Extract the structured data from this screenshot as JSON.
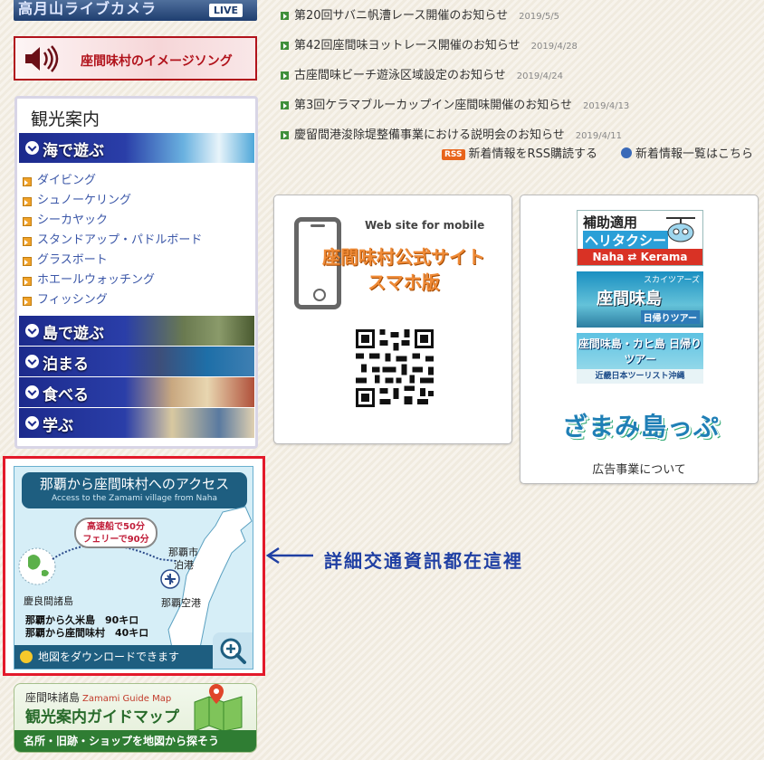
{
  "live_camera": {
    "title": "高月山ライブカメラ",
    "badge": "LIVE"
  },
  "image_song": {
    "label": "座間味村のイメージソング"
  },
  "sightseeing": {
    "title": "観光案内",
    "categories": [
      "海で遊ぶ",
      "島で遊ぶ",
      "泊まる",
      "食べる",
      "学ぶ"
    ],
    "sea_items": [
      "ダイビング",
      "シュノーケリング",
      "シーカヤック",
      "スタンドアップ・パドルボード",
      "グラスボート",
      "ホエールウォッチング",
      "フィッシング"
    ]
  },
  "access_map": {
    "title": "那覇から座間味村へのアクセス",
    "subtitle": "Access to the Zamami village from Naha",
    "balloon_1": "高速船で50分",
    "balloon_2": "フェリーで90分",
    "label_port_1": "那覇市",
    "label_port_2": "泊港",
    "label_airport": "那覇空港",
    "label_islands": "慶良間諸島",
    "dist_1": "那覇から久米島　90キロ",
    "dist_2": "那覇から座間味村　40キロ",
    "download": "地図をダウンロードできます"
  },
  "annotation": "詳細交通資訊都在這裡",
  "guide_map": {
    "line1": "座間味諸島",
    "line1_en": "Zamami Guide Map",
    "title": "観光案内ガイドマップ",
    "tagline": "名所・旧跡・ショップを地図から探そう"
  },
  "news": [
    {
      "title": "第20回サバニ帆漕レース開催のお知らせ",
      "date": "2019/5/5"
    },
    {
      "title": "第42回座間味ヨットレース開催のお知らせ",
      "date": "2019/4/28"
    },
    {
      "title": "古座間味ビーチ遊泳区域設定のお知らせ",
      "date": "2019/4/24"
    },
    {
      "title": "第3回ケラマブルーカップイン座間味開催のお知らせ",
      "date": "2019/4/13"
    },
    {
      "title": "慶留間港浚除堤整備事業における説明会のお知らせ",
      "date": "2019/4/11"
    }
  ],
  "rss": {
    "badge": "RSS",
    "label": "新着情報をRSS購読する"
  },
  "all_news": {
    "label": "新着情報一覧はこちら"
  },
  "mobile": {
    "label_small": "Web site for mobile",
    "line1": "座間味村公式サイト",
    "line2": "スマホ版"
  },
  "ads": {
    "heli": {
      "line1": "補助適用",
      "line2": "ヘリタクシー",
      "route": "Naha ⇄ Kerama"
    },
    "tour1": {
      "brand": "スカイツアーズ",
      "title": "座間味島",
      "sub": "日帰りツアー"
    },
    "tour2": {
      "title": "座間味島・カヒ島 日帰りツアー",
      "sub": "近畿日本ツーリスト沖縄"
    },
    "logo": {
      "text": "ざまみ島っぷ"
    },
    "note": "広告事業について"
  },
  "colors": {
    "accent_red": "#e3192a",
    "nav_blue": "#1c2a8c",
    "link_blue": "#3b57a8",
    "annotation": "#1f3fa3"
  }
}
